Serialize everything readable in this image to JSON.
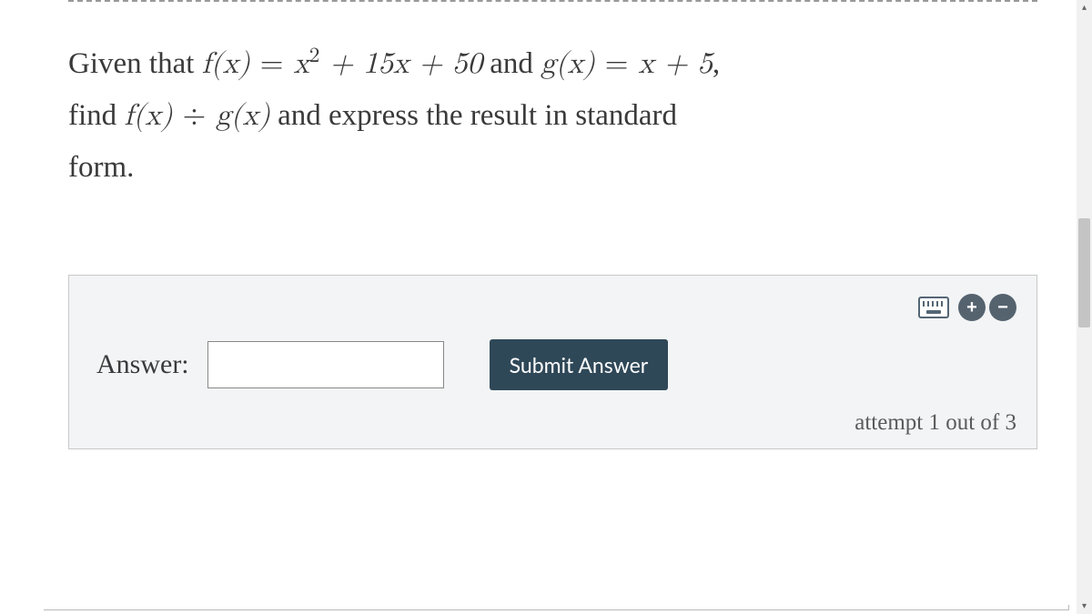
{
  "question": {
    "intro": "Given that ",
    "f_def_lhs": "f(x)",
    "equals": " = ",
    "f_def_rhs_a": "x",
    "f_def_rhs_b": " + 15x + 50",
    "and_text": " and ",
    "g_def_lhs": "g(x)",
    "g_def_rhs": "x + 5",
    "comma": ",",
    "line2_a": "find ",
    "fx": "f(x)",
    "div": " ÷ ",
    "gx": "g(x)",
    "line2_b": " and express the result in standard",
    "line3": "form."
  },
  "answer_panel": {
    "label": "Answer:",
    "input_value": "",
    "submit_label": "Submit Answer",
    "plus_label": "+",
    "minus_label": "−",
    "attempt_text": "attempt 1 out of 3"
  },
  "scroll": {
    "up": "▴",
    "down": "▾"
  }
}
